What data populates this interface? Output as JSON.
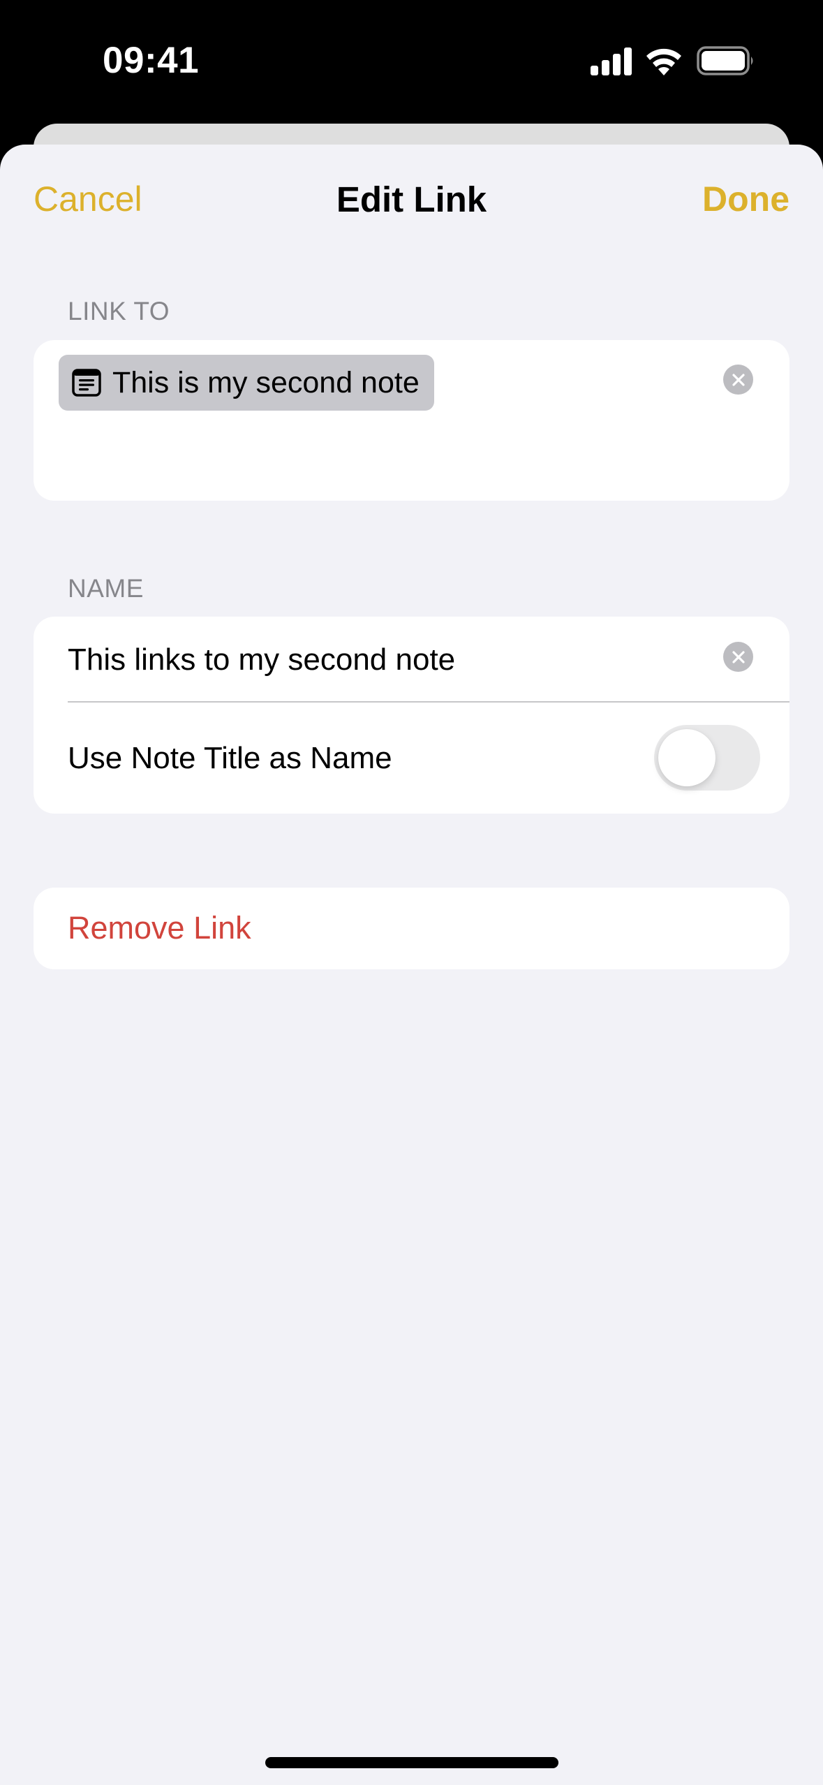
{
  "status_bar": {
    "time": "09:41",
    "icons": [
      "signal-icon",
      "wifi-icon",
      "battery-icon"
    ]
  },
  "nav": {
    "cancel_label": "Cancel",
    "title": "Edit Link",
    "done_label": "Done"
  },
  "link_to": {
    "section_label": "LINK TO",
    "chip": {
      "icon": "note-icon",
      "text": "This is my second note"
    },
    "clear_icon": "clear-icon"
  },
  "name": {
    "section_label": "NAME",
    "value": "This links to my second note",
    "clear_icon": "clear-icon",
    "toggle_label": "Use Note Title as Name",
    "toggle_on": false
  },
  "remove": {
    "label": "Remove Link"
  },
  "colors": {
    "accent": "#dcb12c",
    "destructive": "#d1443c",
    "background": "#f2f2f7",
    "section_label": "#86868b"
  }
}
